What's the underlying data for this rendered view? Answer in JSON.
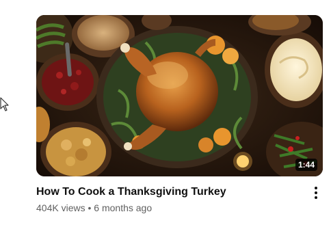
{
  "video": {
    "title": "How To Cook a Thanksgiving Turkey",
    "views": "404K views",
    "separator": "•",
    "age": "6 months ago",
    "duration": "1:44"
  },
  "icons": {
    "menu": "more-vertical-icon",
    "cursor": "mouse-pointer-icon"
  },
  "colors": {
    "title": "#0f0f0f",
    "meta": "#606060",
    "badge_bg": "#000000cc"
  }
}
